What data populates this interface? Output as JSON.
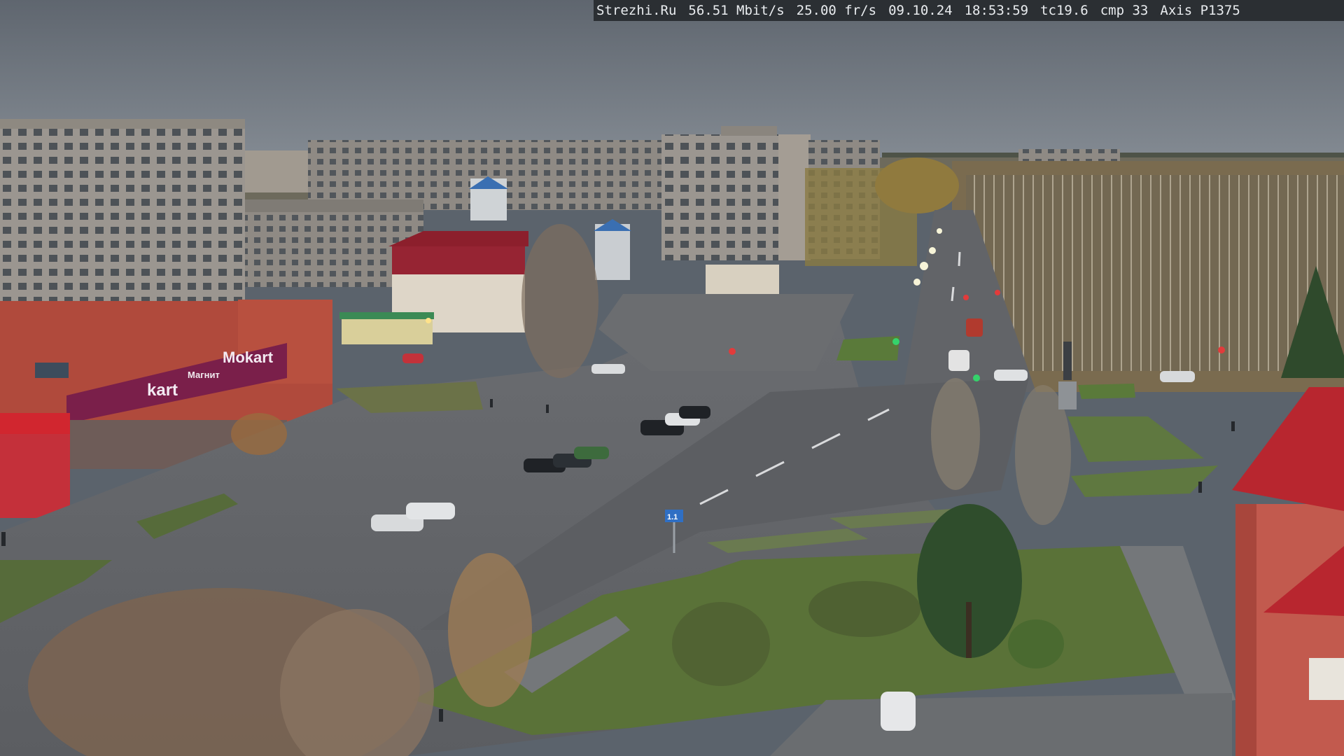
{
  "overlay": {
    "site": "Strezhi.Ru",
    "bitrate": "56.51 Mbit/s",
    "framerate": "25.00 fr/s",
    "date": "09.10.24",
    "time": "18:53:59",
    "tc": "tc19.6",
    "cmp": "cmp 33",
    "camera": "Axis P1375"
  },
  "signs": {
    "store_brand": "Mokart",
    "store_lower": "kart",
    "store_banner": "Магнит",
    "road_sign": "1.1"
  },
  "colors": {
    "sky": "#6b727b",
    "asphalt": "#5f6266",
    "grass": "#5f7840",
    "brick": "#b44a3a",
    "store_purple": "#7a1f4a",
    "roof_red": "#b0202c",
    "osd_bg": "#2b2f33"
  }
}
